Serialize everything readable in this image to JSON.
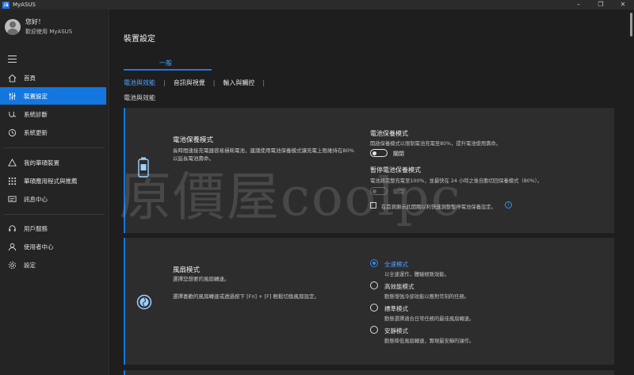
{
  "app": {
    "title": "MyASUS",
    "logo": "/ā"
  },
  "window_controls": {
    "minimize": "–",
    "restore": "❐",
    "close": "✕"
  },
  "user": {
    "greeting": "您好！",
    "welcome": "歡迎使用 MyASUS"
  },
  "nav": [
    {
      "label": "首頁",
      "icon": "home-icon"
    },
    {
      "label": "裝置設定",
      "icon": "sliders-icon",
      "active": true
    },
    {
      "label": "系統診斷",
      "icon": "diagnosis-icon"
    },
    {
      "label": "系統更新",
      "icon": "update-icon"
    },
    {
      "label": "我的華碩裝置",
      "icon": "devices-icon"
    },
    {
      "label": "華碩應用程式與推薦",
      "icon": "apps-icon"
    },
    {
      "label": "訊息中心",
      "icon": "message-icon"
    },
    {
      "label": "用戶服務",
      "icon": "headset-icon"
    },
    {
      "label": "使用者中心",
      "icon": "user-icon"
    },
    {
      "label": "設定",
      "icon": "gear-icon"
    }
  ],
  "page": {
    "title": "裝置設定",
    "tab_general": "一般",
    "subtabs": [
      "電池與效能",
      "音訊與視覺",
      "輸入與觸控"
    ],
    "section_label": "電池與效能"
  },
  "battery_card": {
    "title": "電池保養模式",
    "desc_line1": "長時間連接充電器容易損耗電池，建議使用電池保養模式讓充電上限維持在80%",
    "desc_line2": "以延長電池壽命。",
    "opt1_title": "電池保養模式",
    "opt1_desc": "開啟保養模式以限制電池充電至80%，提升電池使用壽命。",
    "opt1_toggle": "關閉",
    "opt2_title": "暫停電池保養模式",
    "opt2_desc": "電池將完整充電至100%，並最快在 24 小時之後自動切回保養模式（80%）。",
    "opt2_toggle": "關閉",
    "checkbox_label": "在首頁顯示此開關以利快速調整暫停電池保養設定。",
    "info": "i"
  },
  "fan_card": {
    "title": "風扇模式",
    "desc_line1": "選擇您想要的風扇轉速。",
    "desc_line2": "選擇喜歡的風扇轉速或透過按下 [Fn] + [F] 輕鬆切換風扇設定。",
    "options": [
      {
        "label": "全速模式",
        "desc": "以全速運作，體驗極致效能。",
        "checked": true
      },
      {
        "label": "高效能模式",
        "desc": "動態增強冷卻效能以應對苛刻的任務。",
        "checked": false
      },
      {
        "label": "標準模式",
        "desc": "動態選擇適合日常任務的最佳風扇轉速。",
        "checked": false
      },
      {
        "label": "安靜模式",
        "desc": "動態降低風扇轉速，實現最安靜的操作。",
        "checked": false
      }
    ]
  },
  "watermark": "原價屋coolpc",
  "colors": {
    "accent": "#1477e0",
    "link": "#4aa3ff",
    "card_bg": "#2d2d2d"
  }
}
